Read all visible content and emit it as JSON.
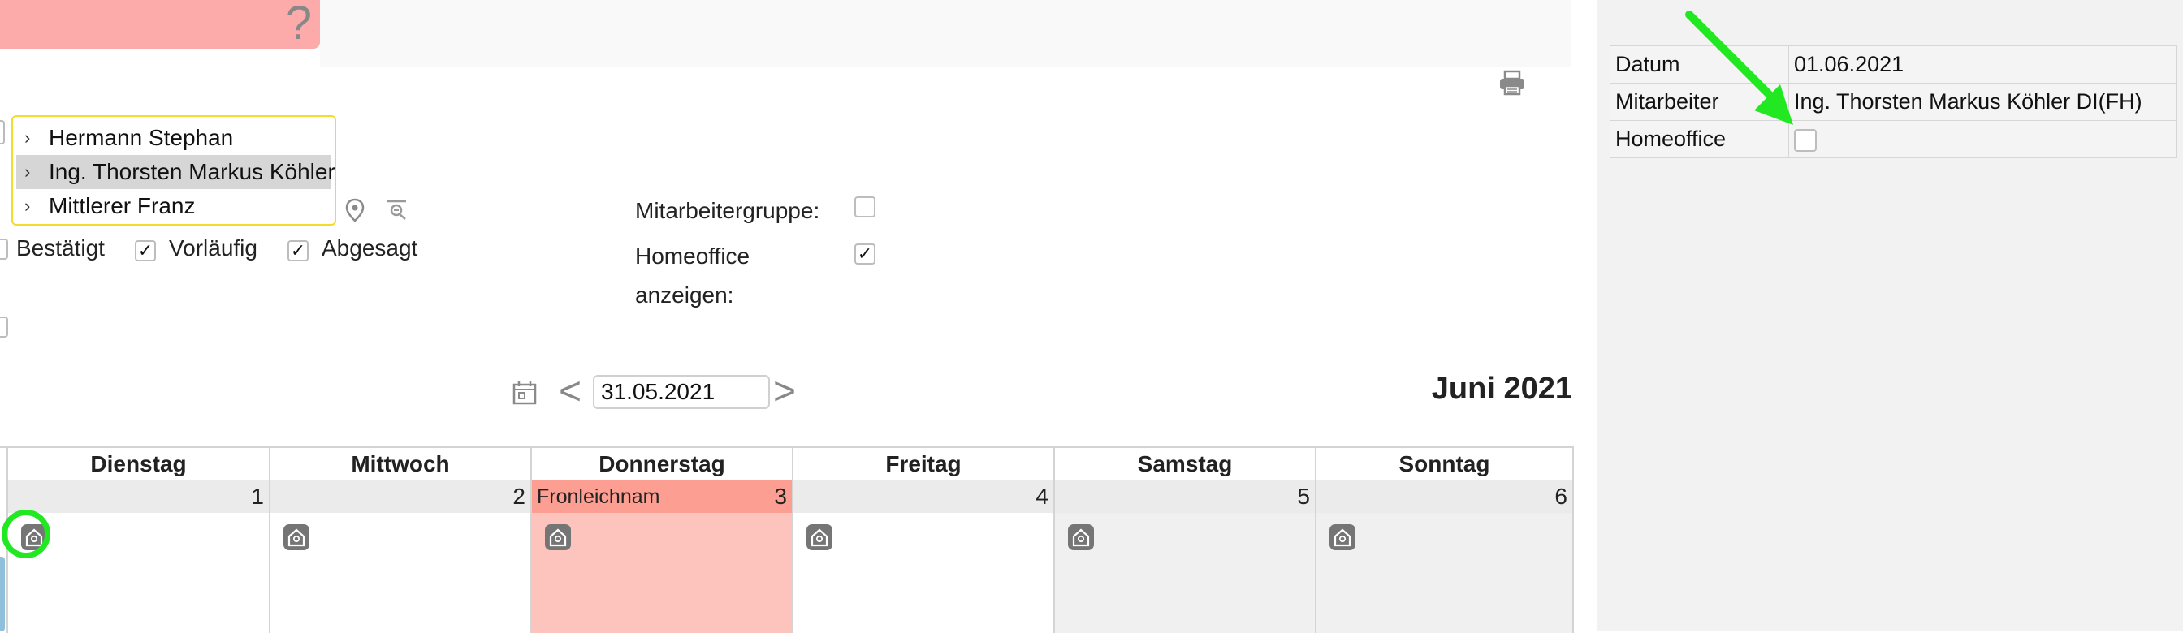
{
  "banner": {
    "icon": "question-icon",
    "color": "#fcaaaa"
  },
  "toolbar": {
    "print_icon": "printer-icon"
  },
  "employees": [
    {
      "label": "Hermann Stephan",
      "selected": false
    },
    {
      "label": "Ing. Thorsten Markus Köhler",
      "selected": true
    },
    {
      "label": "Mittlerer Franz",
      "selected": false
    }
  ],
  "filters": {
    "bestaetigt": {
      "label": "Bestätigt",
      "checked": false
    },
    "vorlaeufig": {
      "label": "Vorläufig",
      "checked": true
    },
    "abgesagt": {
      "label": "Abgesagt",
      "checked": true
    },
    "mitarbeitergruppe": {
      "label": "Mitarbeitergruppe:",
      "checked": false
    },
    "homeoffice_anzeigen": {
      "label": "Homeoffice anzeigen:",
      "checked": true
    }
  },
  "check_mark": "✓",
  "nav": {
    "date": "31.05.2021",
    "prev": "<",
    "next": ">",
    "month_title": "Juni 2021"
  },
  "calendar": {
    "days": [
      {
        "name": "Dienstag",
        "num": "1",
        "holiday": "",
        "type": "workday"
      },
      {
        "name": "Mittwoch",
        "num": "2",
        "holiday": "",
        "type": "workday"
      },
      {
        "name": "Donnerstag",
        "num": "3",
        "holiday": "Fronleichnam",
        "type": "holiday"
      },
      {
        "name": "Freitag",
        "num": "4",
        "holiday": "",
        "type": "workday"
      },
      {
        "name": "Samstag",
        "num": "5",
        "holiday": "",
        "type": "weekend"
      },
      {
        "name": "Sonntag",
        "num": "6",
        "holiday": "",
        "type": "weekend"
      }
    ],
    "colors": {
      "holiday_header": "#fc9e92",
      "holiday_body": "#fcc4bc",
      "weekend": "#f0f0f0"
    }
  },
  "details": {
    "rows": [
      {
        "key": "Datum",
        "value": "01.06.2021"
      },
      {
        "key": "Mitarbeiter",
        "value": "Ing. Thorsten Markus Köhler DI(FH)"
      },
      {
        "key": "Homeoffice",
        "value": ""
      }
    ],
    "homeoffice_checked": false
  },
  "annotation": {
    "arrow_color": "#22e822"
  }
}
